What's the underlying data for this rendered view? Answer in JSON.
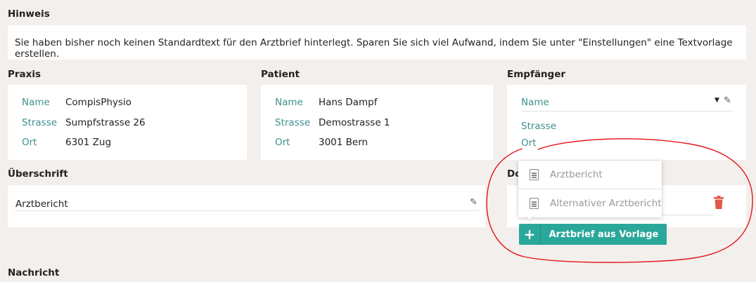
{
  "hinweis": {
    "title": "Hinweis",
    "text": "Sie haben bisher noch keinen Standardtext für den Arztbrief hinterlegt. Sparen Sie sich viel Aufwand, indem Sie unter \"Einstellungen\" eine Textvorlage erstellen."
  },
  "praxis": {
    "title": "Praxis",
    "name_label": "Name",
    "name_value": "CompisPhysio",
    "strasse_label": "Strasse",
    "strasse_value": "Sumpfstrasse 26",
    "ort_label": "Ort",
    "ort_value": "6301 Zug"
  },
  "patient": {
    "title": "Patient",
    "name_label": "Name",
    "name_value": "Hans Dampf",
    "strasse_label": "Strasse",
    "strasse_value": "Demostrasse 1",
    "ort_label": "Ort",
    "ort_value": "3001 Bern"
  },
  "empfaenger": {
    "title": "Empfänger",
    "name_label": "Name",
    "strasse_label": "Strasse",
    "ort_label": "Ort"
  },
  "ueberschrift": {
    "title": "Überschrift",
    "value": "Arztbericht"
  },
  "dokument": {
    "title_partial": "Do"
  },
  "template_menu": {
    "items": [
      "Arztbericht",
      "Alternativer Arztbericht"
    ]
  },
  "template_button": {
    "label": "Arztbrief aus Vorlage"
  },
  "nachricht": {
    "title": "Nachricht"
  },
  "colors": {
    "accent": "#3e8f8c",
    "button": "#2aa79b",
    "delete": "#e05a47",
    "annotation": "#e3141b"
  }
}
